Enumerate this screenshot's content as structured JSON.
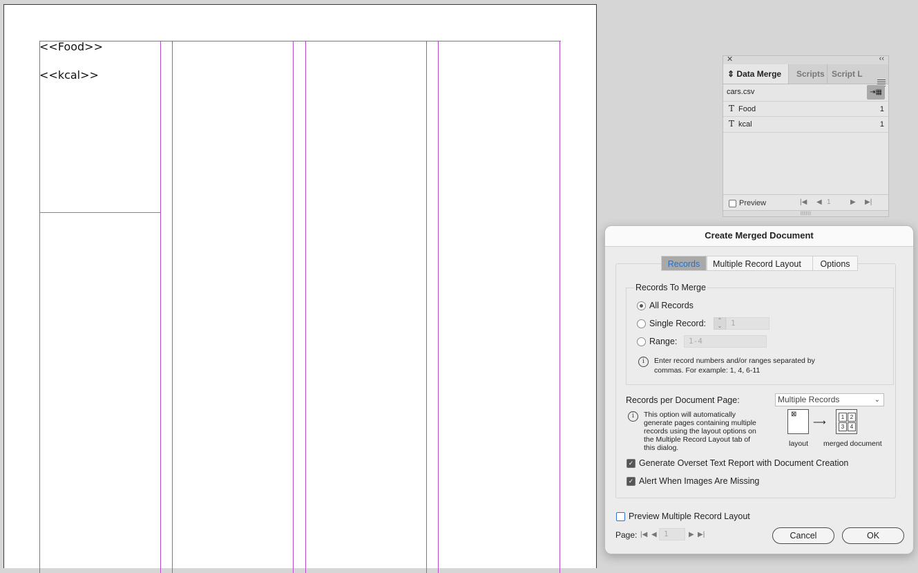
{
  "document": {
    "placeholders": [
      "<<Food>>",
      "<<kcal>>"
    ]
  },
  "data_merge_panel": {
    "tabs": [
      "Data Merge",
      "Scripts",
      "Script L"
    ],
    "source_file": "cars.csv",
    "fields": [
      {
        "type_icon": "T",
        "name": "Food",
        "count": "1"
      },
      {
        "type_icon": "T",
        "name": "kcal",
        "count": "1"
      }
    ],
    "preview_label": "Preview",
    "preview_checked": false,
    "record_number": "1"
  },
  "dialog": {
    "title": "Create Merged Document",
    "tabs": [
      "Records",
      "Multiple Record Layout",
      "Options"
    ],
    "active_tab": "Records",
    "records_to_merge": {
      "legend": "Records To Merge",
      "options": [
        "All Records",
        "Single Record:",
        "Range:"
      ],
      "selected": "All Records",
      "single_record_value": "1",
      "range_value": "1-4",
      "hint": [
        "Enter record numbers and/or ranges separated by",
        "commas. For example: 1, 4, 6-11"
      ]
    },
    "records_per_page": {
      "label": "Records per Document Page:",
      "value": "Multiple Records",
      "info": [
        "This option will automatically",
        "generate pages containing multiple",
        "records using the layout options on",
        "the Multiple Record Layout tab of",
        "this dialog."
      ],
      "layout_caption": "layout",
      "merged_caption": "merged document",
      "merged_numbers": [
        "1",
        "2",
        "3",
        "4"
      ]
    },
    "checkboxes": [
      {
        "label": "Generate Overset Text Report with Document Creation",
        "checked": true
      },
      {
        "label": "Alert When Images Are Missing",
        "checked": true
      }
    ],
    "preview_layout": {
      "label": "Preview Multiple Record Layout",
      "checked": false
    },
    "page_label": "Page:",
    "page_value": "1",
    "cancel_label": "Cancel",
    "ok_label": "OK",
    "colors": {
      "accent": "#1a73d6",
      "guide": "#b84bcc",
      "frame": "#5a8fd4"
    }
  }
}
